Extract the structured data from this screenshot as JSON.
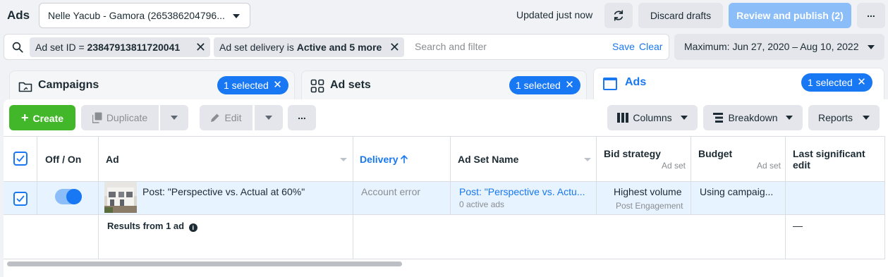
{
  "header": {
    "title": "Ads",
    "account": "Nelle Yacub - Gamora (265386204796...",
    "status": "Updated just now",
    "discard_label": "Discard drafts",
    "review_label": "Review and publish (2)",
    "more_label": "..."
  },
  "filters": {
    "chip1_prefix": "Ad set ID = ",
    "chip1_value": "23847913811720041",
    "chip2_prefix": "Ad set delivery is ",
    "chip2_value": "Active and 5 more",
    "placeholder": "Search and filter",
    "save_label": "Save",
    "clear_label": "Clear",
    "date_range": "Maximum: Jun 27, 2020 – Aug 10, 2022"
  },
  "tabs": [
    {
      "label": "Campaigns",
      "selected": "1 selected"
    },
    {
      "label": "Ad sets",
      "selected": "1 selected"
    },
    {
      "label": "Ads",
      "selected": "1 selected"
    }
  ],
  "toolbar": {
    "create_label": "Create",
    "duplicate_label": "Duplicate",
    "edit_label": "Edit",
    "more_label": "...",
    "columns_label": "Columns",
    "breakdown_label": "Breakdown",
    "reports_label": "Reports"
  },
  "table": {
    "headers": {
      "toggle": "Off / On",
      "ad": "Ad",
      "delivery": "Delivery",
      "adset_name": "Ad Set Name",
      "bid_strategy": "Bid strategy",
      "bid_strategy_sub": "Ad set",
      "budget": "Budget",
      "budget_sub": "Ad set",
      "last_edit_1": "Last significant",
      "last_edit_2": "edit"
    },
    "row": {
      "ad_name": "Post: \"Perspective vs. Actual at 60%\"",
      "delivery": "Account error",
      "adset_name": "Post: \"Perspective vs. Actu...",
      "adset_sub": "0 active ads",
      "bid_strategy": "Highest volume",
      "bid_sub": "Post Engagement",
      "budget": "Using campaig..."
    },
    "results_label": "Results from 1 ad",
    "results_last_edit": "—"
  },
  "colors": {
    "accent": "#1877f2",
    "create": "#42b72a",
    "selected_row": "#e7f3ff"
  }
}
